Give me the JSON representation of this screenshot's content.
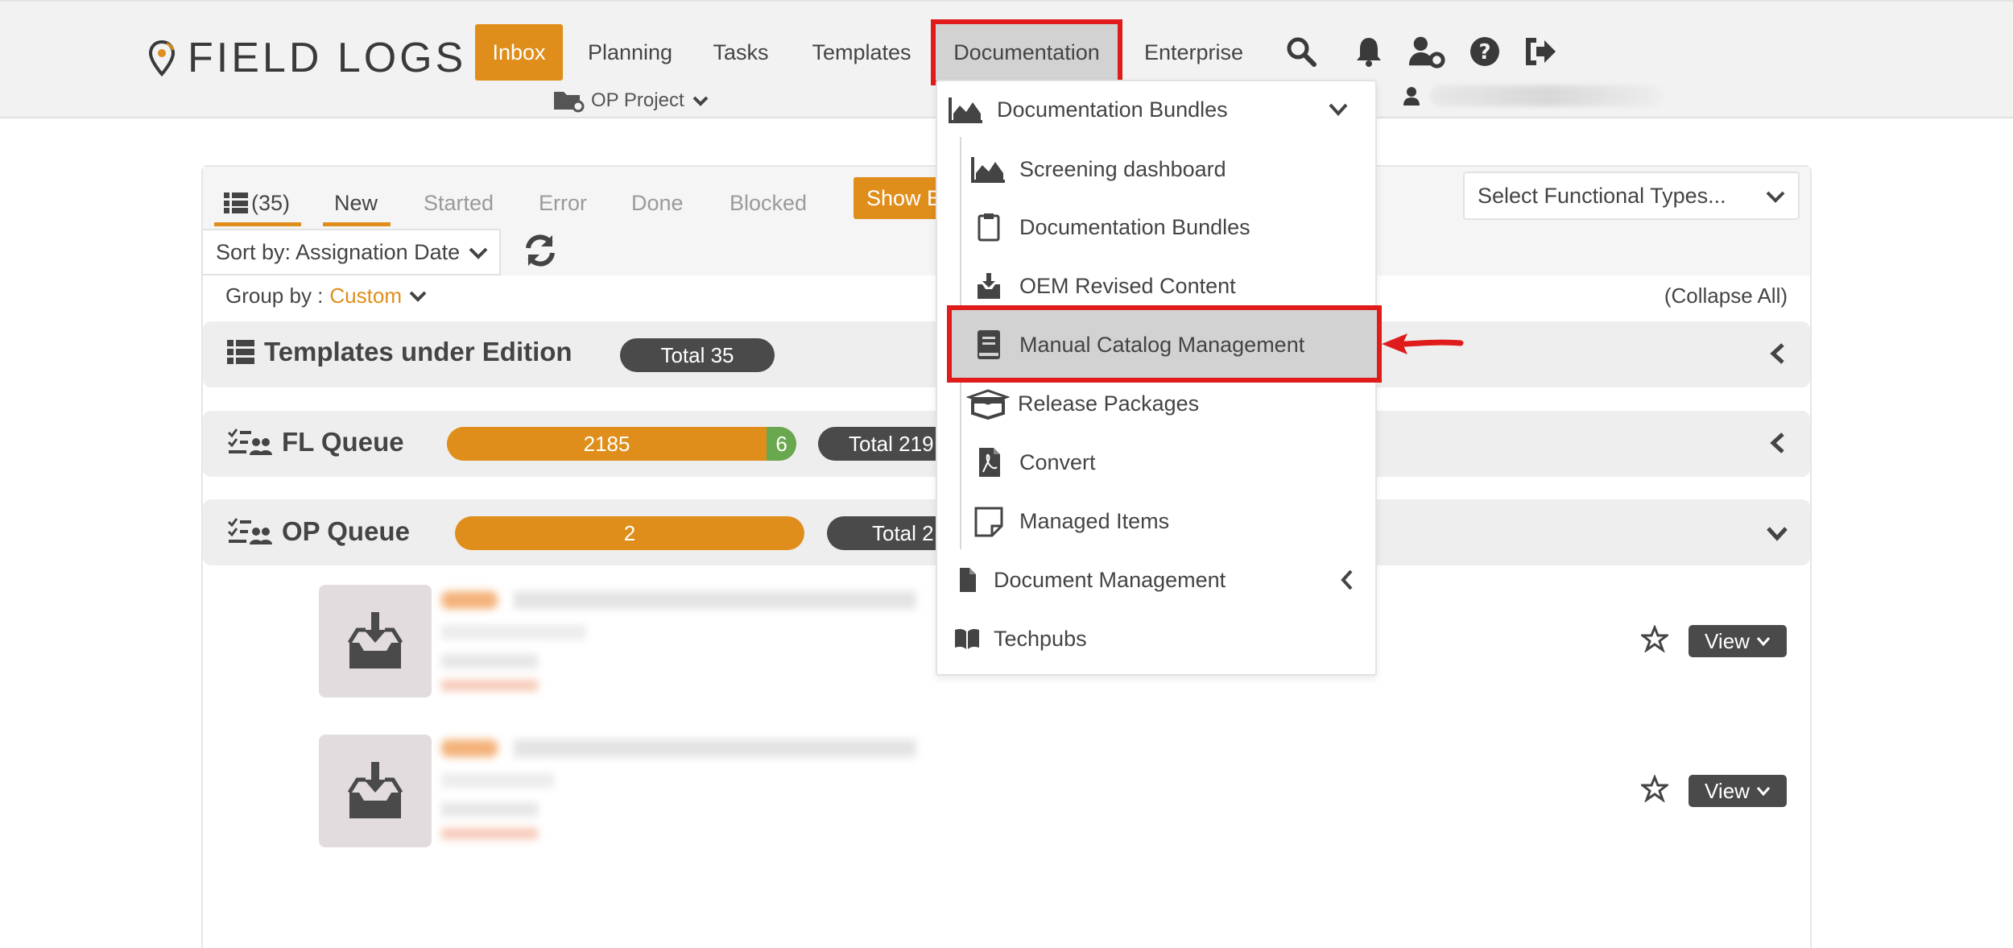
{
  "header": {
    "logo_text": "FIELD LOGS",
    "nav": {
      "inbox": "Inbox",
      "planning": "Planning",
      "tasks": "Tasks",
      "templates": "Templates",
      "documentation": "Documentation",
      "enterprise": "Enterprise"
    },
    "project": "OP Project",
    "icons": [
      "search-icon",
      "bell-icon",
      "user-gear-icon",
      "help-icon",
      "sign-out-icon"
    ]
  },
  "tabs": {
    "count_label": "(35)",
    "items": [
      "New",
      "Started",
      "Error",
      "Done",
      "Blocked"
    ],
    "show_button": "Show B",
    "functional_types_placeholder": "Select Functional Types..."
  },
  "toolbar": {
    "sort_label": "Sort by: Assignation Date",
    "group_by_label": "Group by :",
    "group_by_value": "Custom",
    "collapse_all": "(Collapse All)"
  },
  "groups": {
    "templates": {
      "title": "Templates under Edition",
      "total": "Total 35"
    },
    "fl_queue": {
      "title": "FL Queue",
      "main_count": "2185",
      "green_count": "6",
      "main_fraction": 0.915,
      "total": "Total 219"
    },
    "op_queue": {
      "title": "OP Queue",
      "main_count": "2",
      "total": "Total 2"
    }
  },
  "items": {
    "view_label": "View"
  },
  "dropdown": {
    "bundles_header": "Documentation Bundles",
    "sub_items": [
      "Screening dashboard",
      "Documentation Bundles",
      "OEM Revised Content",
      "Manual Catalog Management",
      "Release Packages",
      "Convert",
      "Managed Items"
    ],
    "document_management": "Document Management",
    "techpubs": "Techpubs"
  },
  "colors": {
    "accent": "#e08e1b",
    "highlight": "#e01b1b",
    "green": "#6aa84f",
    "dark_pill": "#4a4a4a"
  }
}
